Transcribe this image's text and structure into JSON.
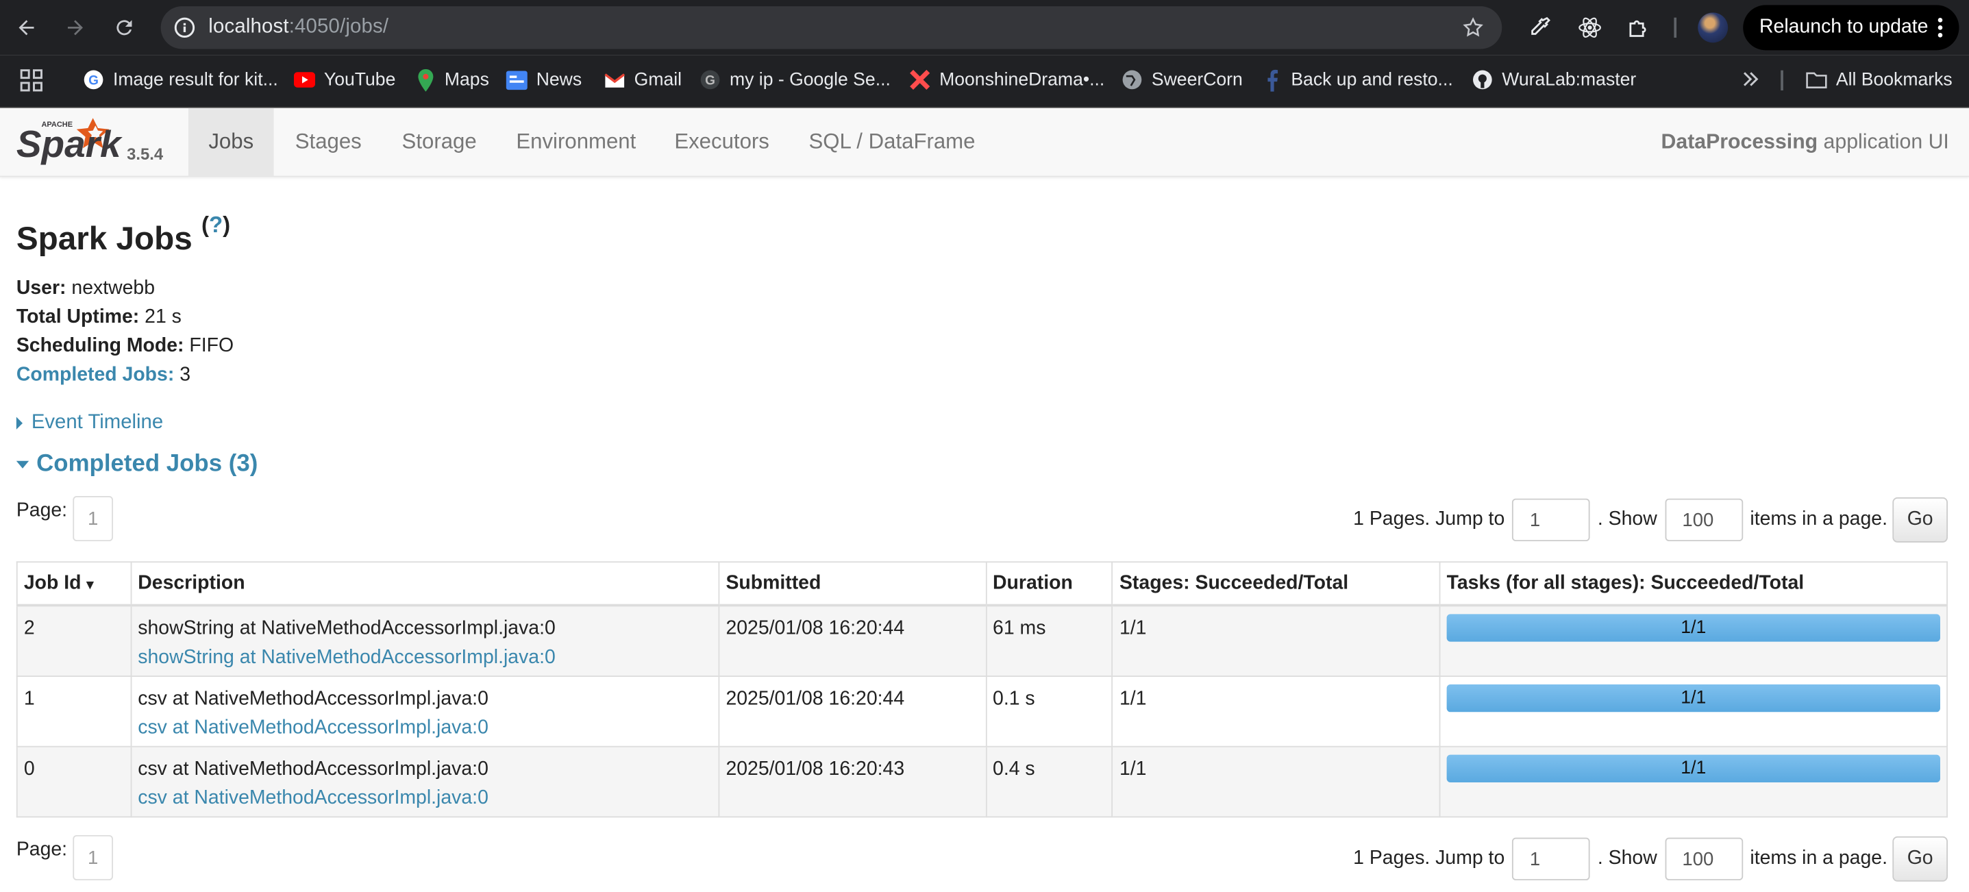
{
  "browser": {
    "url_host": "localhost",
    "url_path": ":4050/jobs/",
    "relaunch_label": "Relaunch to update",
    "bookmarks": [
      {
        "label": "Image result for kit...",
        "icon": "google-icon"
      },
      {
        "label": "YouTube",
        "icon": "youtube-icon"
      },
      {
        "label": "Maps",
        "icon": "maps-icon"
      },
      {
        "label": "News",
        "icon": "news-icon"
      },
      {
        "label": "Gmail",
        "icon": "gmail-icon"
      },
      {
        "label": "my ip - Google Se...",
        "icon": "google-icon"
      },
      {
        "label": "MoonshineDrama•...",
        "icon": "moonshine-icon"
      },
      {
        "label": "SweerCorn",
        "icon": "globe-icon"
      },
      {
        "label": "Back up and resto...",
        "icon": "facebook-icon"
      },
      {
        "label": "WuraLab:master",
        "icon": "github-icon"
      }
    ],
    "all_bookmarks_label": "All Bookmarks"
  },
  "spark": {
    "version": "3.5.4",
    "tabs": [
      "Jobs",
      "Stages",
      "Storage",
      "Environment",
      "Executors",
      "SQL / DataFrame"
    ],
    "active_tab": "Jobs",
    "app_name": "DataProcessing",
    "app_suffix": " application UI"
  },
  "page": {
    "title": "Spark Jobs",
    "help_mark": "?",
    "user_label": "User:",
    "user_value": "nextwebb",
    "uptime_label": "Total Uptime:",
    "uptime_value": "21 s",
    "sched_label": "Scheduling Mode:",
    "sched_value": "FIFO",
    "completed_label": "Completed Jobs:",
    "completed_value": "3",
    "event_timeline": "Event Timeline",
    "section_title": "Completed Jobs (3)"
  },
  "pager": {
    "page_label": "Page:",
    "current_page": "1",
    "pages_text": "1 Pages. Jump to",
    "jump_value": "1",
    "show_text": ". Show",
    "show_value": "100",
    "items_text": "items in a page.",
    "go_label": "Go"
  },
  "table": {
    "headers": [
      "Job Id",
      "Description",
      "Submitted",
      "Duration",
      "Stages: Succeeded/Total",
      "Tasks (for all stages): Succeeded/Total"
    ],
    "sort_indicator": "▾",
    "rows": [
      {
        "id": "2",
        "desc": "showString at NativeMethodAccessorImpl.java:0",
        "desc_link": "showString at NativeMethodAccessorImpl.java:0",
        "submitted": "2025/01/08 16:20:44",
        "duration": "61 ms",
        "stages": "1/1",
        "tasks": "1/1",
        "tasks_fraction": 1.0
      },
      {
        "id": "1",
        "desc": "csv at NativeMethodAccessorImpl.java:0",
        "desc_link": "csv at NativeMethodAccessorImpl.java:0",
        "submitted": "2025/01/08 16:20:44",
        "duration": "0.1 s",
        "stages": "1/1",
        "tasks": "1/1",
        "tasks_fraction": 1.0
      },
      {
        "id": "0",
        "desc": "csv at NativeMethodAccessorImpl.java:0",
        "desc_link": "csv at NativeMethodAccessorImpl.java:0",
        "submitted": "2025/01/08 16:20:43",
        "duration": "0.4 s",
        "stages": "1/1",
        "tasks": "1/1",
        "tasks_fraction": 1.0
      }
    ]
  },
  "colors": {
    "link": "#3a87ad",
    "progress": "#5aa9e0",
    "chrome_bg": "#202124"
  }
}
